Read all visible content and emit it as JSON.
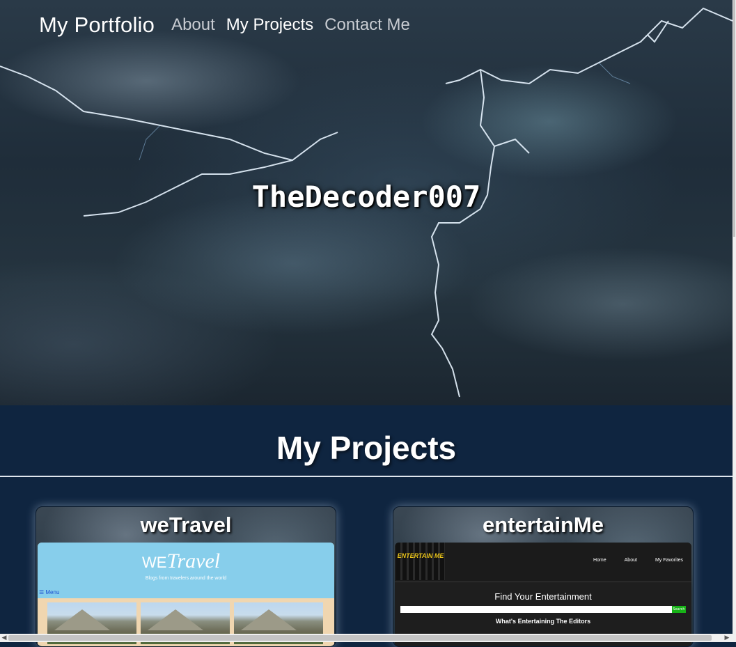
{
  "nav": {
    "brand": "My Portfolio",
    "links": [
      "About",
      "My Projects",
      "Contact Me"
    ]
  },
  "hero": {
    "title": "TheDecoder007"
  },
  "projects": {
    "heading": "My Projects",
    "cards": [
      {
        "title": "weTravel",
        "preview": {
          "logo_we": "WE",
          "logo_travel": "Travel",
          "tagline": "Blogs from travelers around the world",
          "menu": "☰ Menu"
        }
      },
      {
        "title": "entertainMe",
        "preview": {
          "logo": "ENTERTAIN ME",
          "nav": [
            "Home",
            "About",
            "My Favorites"
          ],
          "heading": "Find Your Entertainment",
          "search_button": "Search",
          "subheading": "What's Entertaining The Editors"
        }
      }
    ]
  }
}
